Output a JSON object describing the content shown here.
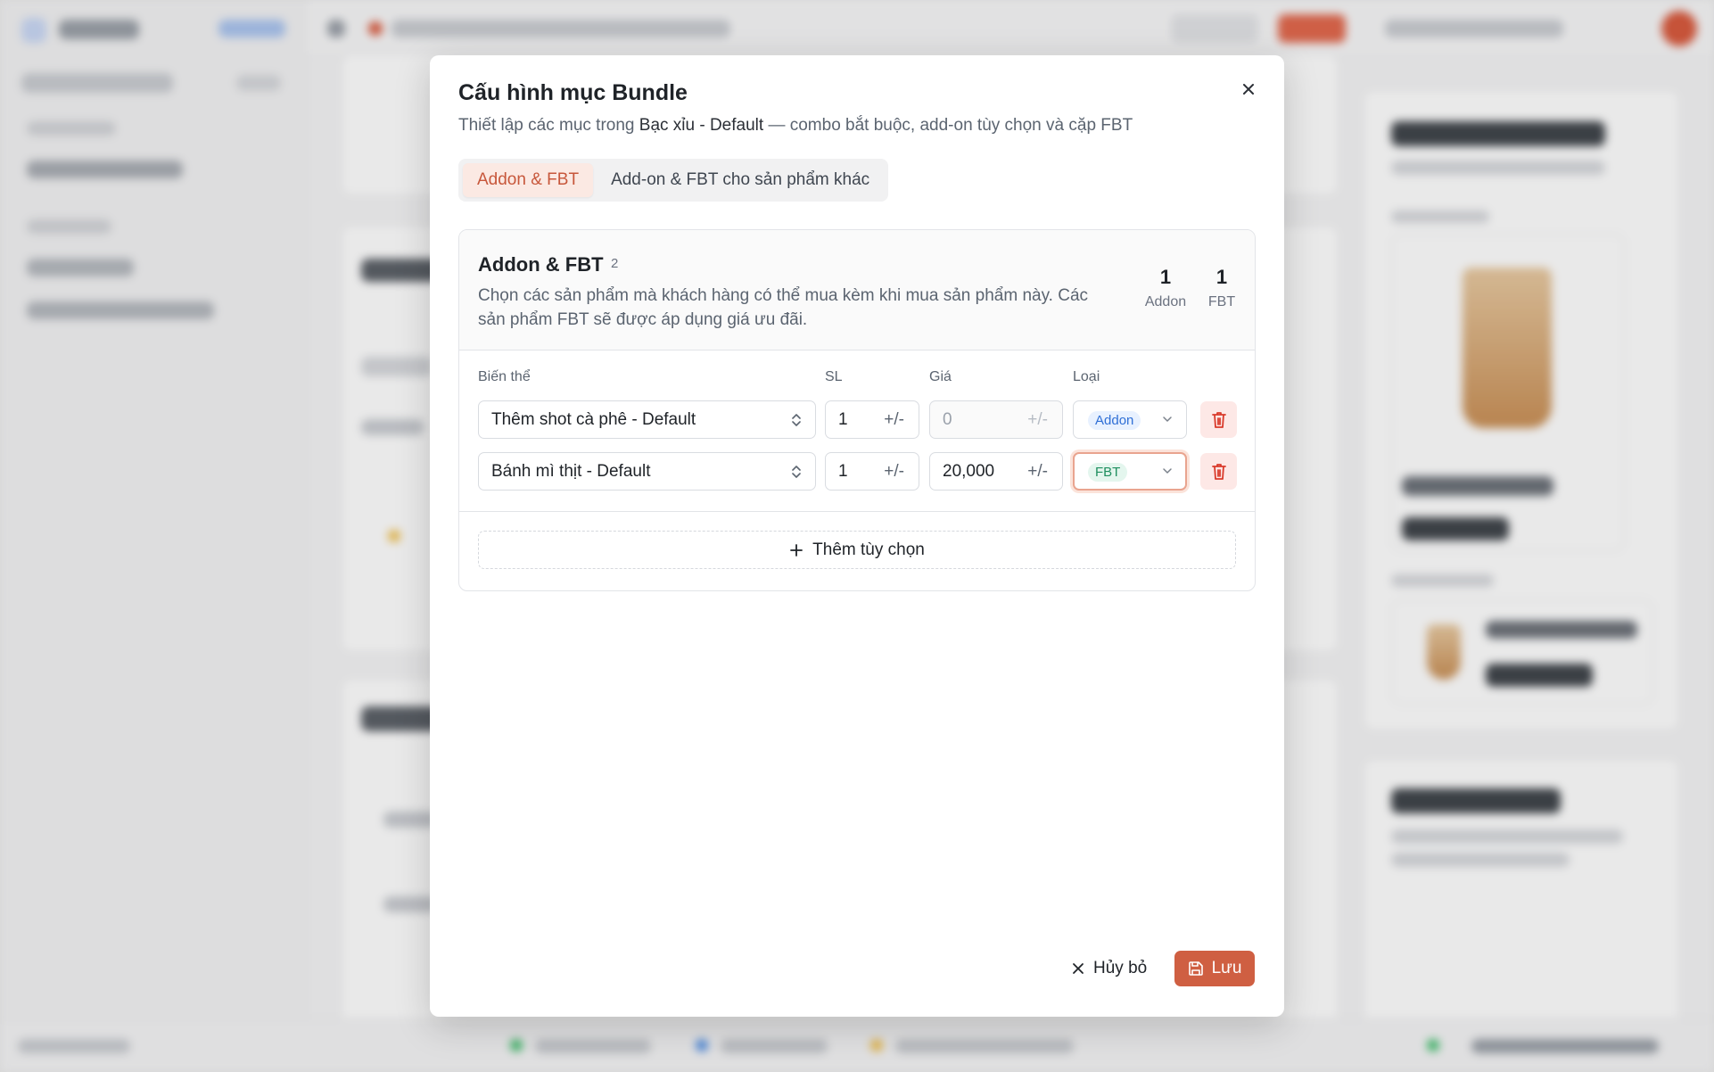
{
  "modal": {
    "title": "Cấu hình mục Bundle",
    "subtitle_prefix": "Thiết lập các mục trong ",
    "subtitle_product": "Bạc xỉu - Default",
    "subtitle_suffix": " — combo bắt buộc, add-on tùy chọn và cặp FBT"
  },
  "tabs": [
    {
      "label": "Addon & FBT",
      "active": true
    },
    {
      "label": "Add-on & FBT cho sản phẩm khác",
      "active": false
    }
  ],
  "section": {
    "title": "Addon & FBT",
    "count": "2",
    "description": "Chọn các sản phẩm mà khách hàng có thể mua kèm khi mua sản phẩm này. Các sản phẩm FBT sẽ được áp dụng giá ưu đãi.",
    "stats": [
      {
        "value": "1",
        "label": "Addon"
      },
      {
        "value": "1",
        "label": "FBT"
      }
    ]
  },
  "table": {
    "columns": [
      "Biến thể",
      "SL",
      "Giá",
      "Loại"
    ],
    "rows": [
      {
        "variant": "Thêm shot cà phê - Default",
        "qty": "1",
        "qty_suffix": "+/-",
        "price": "0",
        "price_suffix": "+/-",
        "type": "Addon"
      },
      {
        "variant": "Bánh mì thịt - Default",
        "qty": "1",
        "qty_suffix": "+/-",
        "price": "20,000",
        "price_suffix": "+/-",
        "type": "FBT"
      }
    ]
  },
  "add_option_label": "Thêm tùy chọn",
  "footer": {
    "cancel_label": "Hủy bỏ",
    "save_label": "Lưu"
  },
  "colors": {
    "accent": "#cf5f42",
    "tab_active_bg": "#fbe9e3",
    "addon_badge": "#2f6fd6",
    "fbt_badge": "#1f8f5f",
    "delete_bg": "#fde8e6"
  }
}
